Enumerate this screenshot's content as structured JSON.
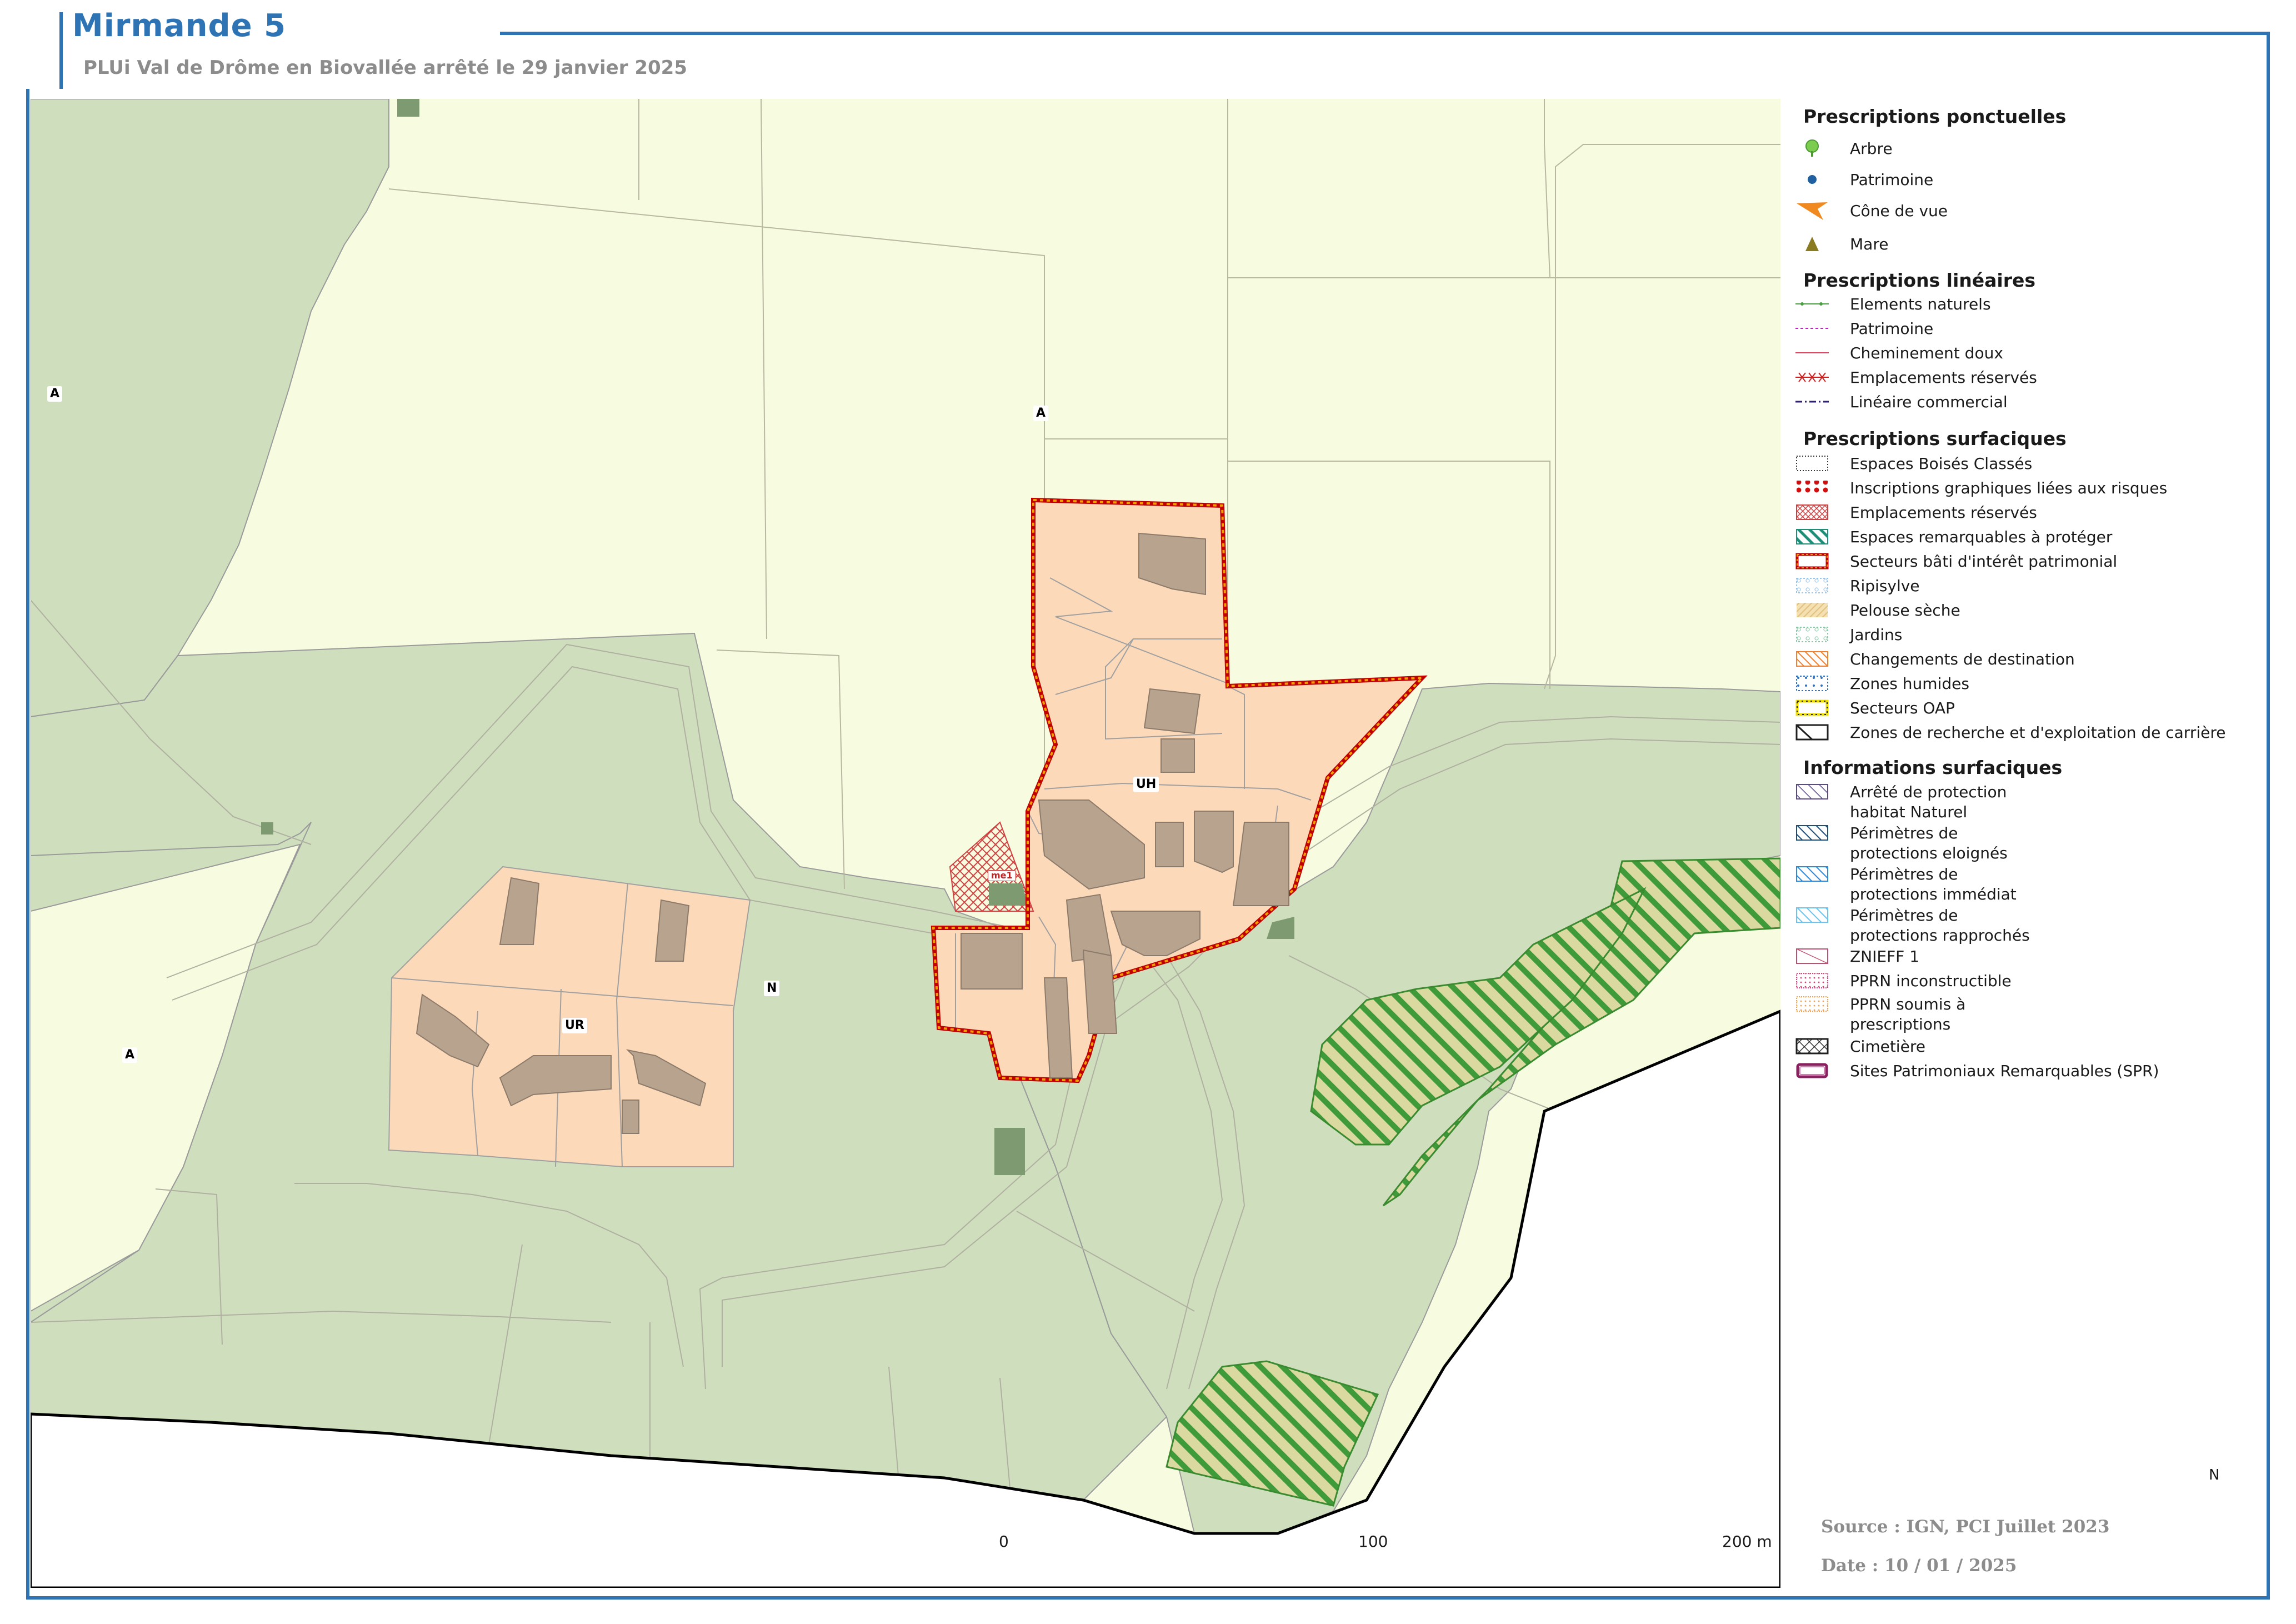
{
  "header": {
    "title": "Mirmande 5",
    "subtitle": "PLUi Val de Drôme en Biovallée arrêté le 29 janvier 2025"
  },
  "colors": {
    "frame_blue": "#2e74b5",
    "zone_A": "#f7fbe0",
    "zone_N": "#cfdfbd",
    "zone_U": "#fcd9b9",
    "building": "#b8a38f",
    "patrimonial_border": "#c00000"
  },
  "map": {
    "zone_labels": [
      "A",
      "A",
      "A",
      "N",
      "UH",
      "UR"
    ],
    "reserved_label": "me1"
  },
  "legend": {
    "ponctuelles": {
      "heading": "Prescriptions ponctuelles",
      "items": [
        {
          "label": "Arbre",
          "icon": "tree-icon"
        },
        {
          "label": "Patrimoine",
          "icon": "dot-icon"
        },
        {
          "label": "Cône de vue",
          "icon": "view-cone-icon"
        },
        {
          "label": "Mare",
          "icon": "triangle-icon"
        }
      ]
    },
    "lineaires": {
      "heading": "Prescriptions linéaires",
      "items": [
        {
          "label": "Elements naturels"
        },
        {
          "label": "Patrimoine"
        },
        {
          "label": "Cheminement doux"
        },
        {
          "label": "Emplacements réservés"
        },
        {
          "label": "Linéaire commercial"
        }
      ]
    },
    "surfaciques": {
      "heading": "Prescriptions surfaciques",
      "items": [
        {
          "label": "Espaces Boisés Classés"
        },
        {
          "label": "Inscriptions graphiques liées aux risques"
        },
        {
          "label": "Emplacements réservés"
        },
        {
          "label": "Espaces remarquables à protéger"
        },
        {
          "label": "Secteurs bâti d'intérêt patrimonial"
        },
        {
          "label": "Ripisylve"
        },
        {
          "label": "Pelouse sèche"
        },
        {
          "label": "Jardins"
        },
        {
          "label": "Changements de destination"
        },
        {
          "label": "Zones humides"
        },
        {
          "label": "Secteurs OAP"
        },
        {
          "label": "Zones de recherche et d'exploitation de carrière"
        }
      ]
    },
    "informations": {
      "heading": "Informations surfaciques",
      "items": [
        {
          "line1": "Arrêté de protection",
          "line2": "habitat Naturel"
        },
        {
          "line1": "Périmètres de",
          "line2": "protections eloignés"
        },
        {
          "line1": "Périmètres de",
          "line2": "protections immédiat"
        },
        {
          "line1": "Périmètres de",
          "line2": "protections rapprochés"
        },
        {
          "line1": "ZNIEFF 1",
          "line2": ""
        },
        {
          "line1": "PPRN inconstructible",
          "line2": ""
        },
        {
          "line1": "PPRN soumis à",
          "line2": "prescriptions"
        },
        {
          "line1": "Cimetière",
          "line2": ""
        },
        {
          "line1": "Sites Patrimoniaux Remarquables (SPR)",
          "line2": ""
        }
      ]
    }
  },
  "scale": {
    "ticks": [
      "0",
      "100",
      "200 m"
    ]
  },
  "source": {
    "source_text": "Source : IGN, PCI Juillet 2023",
    "date_text": "Date : 10 / 01 / 2025"
  },
  "north": {
    "label": "N"
  }
}
